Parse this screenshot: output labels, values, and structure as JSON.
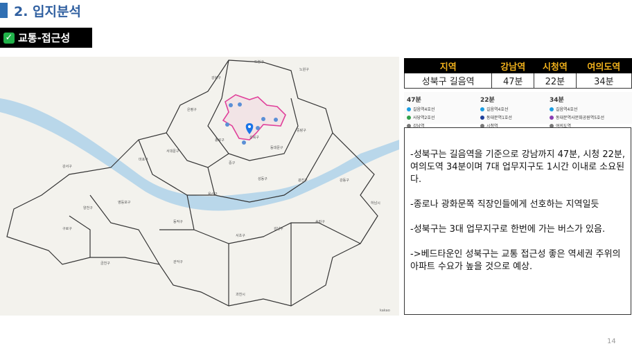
{
  "header": {
    "title": "2. 입지분석"
  },
  "subtitle": {
    "label": "교통-접근성"
  },
  "table": {
    "headers": [
      "지역",
      "강남역",
      "시청역",
      "여의도역"
    ],
    "row": [
      "성북구 길음역",
      "47분",
      "22분",
      "34분"
    ]
  },
  "routes": [
    {
      "time": "47분",
      "stops": [
        "길음역4호선",
        "사당역2호선",
        "강남역"
      ]
    },
    {
      "time": "22분",
      "stops": [
        "길음역4호선",
        "동대문역1호선",
        "시청역"
      ]
    },
    {
      "time": "34분",
      "stops": [
        "길음역4호선",
        "동대문역사문화공원역5호선",
        "여의도역"
      ]
    }
  ],
  "description": [
    "-성북구는 길음역을 기준으로 강남까지 47분, 시청 22분, 여의도역 34분이며 7대 업무지구도 1시간 이내로 소요된다.",
    "-종로나 광화문쪽 직장인들에게 선호하는 지역일듯",
    "-성북구는 3대 업무지구로 한번에 가는 버스가 있음.",
    "->베드타운인 성북구는 교통 접근성 좋은 역세권 주위의 아파트 수요가 높을 것으로 예상."
  ],
  "map": {
    "district_labels": [
      "도봉구",
      "강북구",
      "노원구",
      "은평구",
      "성북구",
      "종로구",
      "중랑구",
      "동대문구",
      "서대문구",
      "마포구",
      "중구",
      "성동구",
      "광진구",
      "용산구",
      "강동구",
      "강서구",
      "영등포구",
      "동작구",
      "서초구",
      "강남구",
      "송파구",
      "구로구",
      "관악구",
      "양천구",
      "금천구",
      "하남시",
      "과천시"
    ],
    "attribution": "kakao"
  },
  "page": {
    "number": "14"
  },
  "colors": {
    "accent": "#2f6fb3",
    "table_header_text": "#f2b21c",
    "highlight": "#e0409a"
  }
}
